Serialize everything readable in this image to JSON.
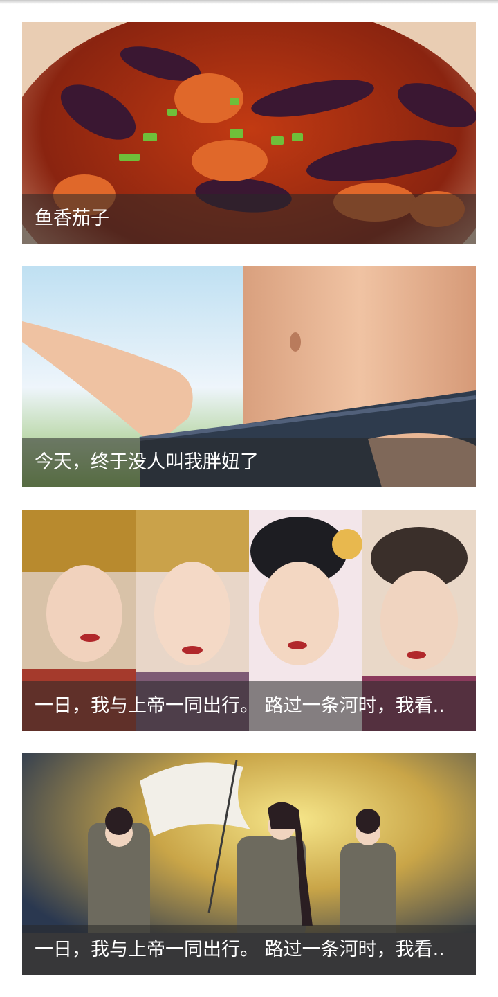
{
  "feed": {
    "items": [
      {
        "caption": "鱼香茄子",
        "image": "braised-eggplant-dish-photo"
      },
      {
        "caption": "今天，终于没人叫我胖妞了",
        "image": "slim-waist-jeans-photo"
      },
      {
        "caption": "一日，我与上帝一同出行。 路过一条河时，我看..",
        "image": "empress-portraits-collage"
      },
      {
        "caption": "一日，我与上帝一同出行。 路过一条河时，我看..",
        "image": "anime-students-flag-illustration"
      }
    ]
  }
}
